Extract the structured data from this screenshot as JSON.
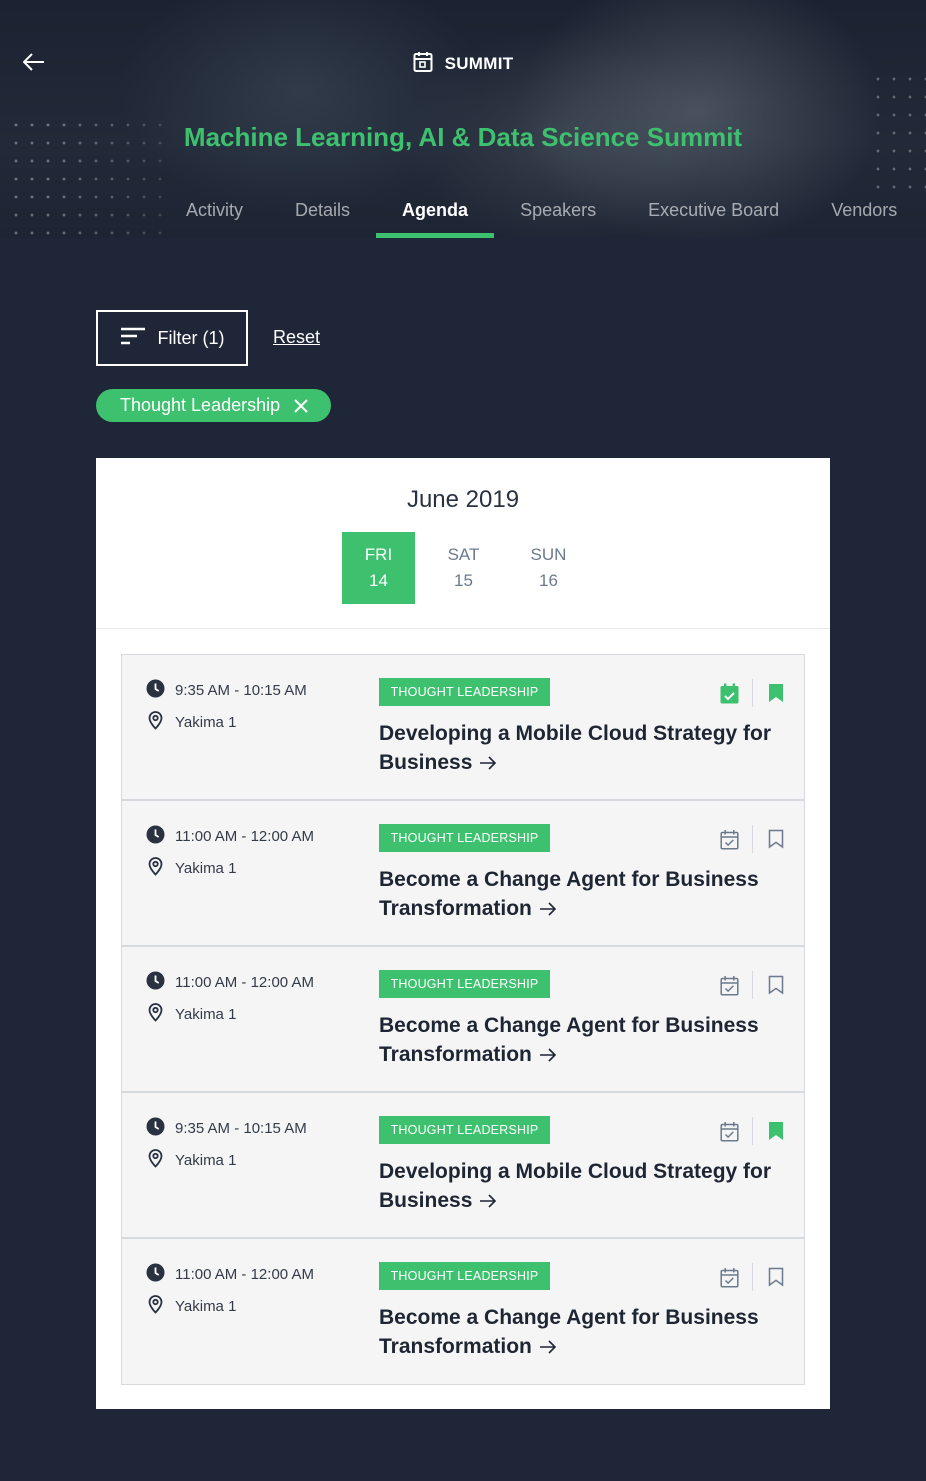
{
  "header": {
    "top_label": "SUMMIT",
    "title": "Machine Learning, AI & Data Science Summit",
    "tabs": [
      {
        "label": "Activity"
      },
      {
        "label": "Details"
      },
      {
        "label": "Agenda"
      },
      {
        "label": "Speakers"
      },
      {
        "label": "Executive Board"
      },
      {
        "label": "Vendors"
      }
    ],
    "active_tab": "Agenda"
  },
  "filters": {
    "filter_label": "Filter (1)",
    "reset_label": "Reset",
    "chip_label": "Thought Leadership"
  },
  "agenda": {
    "month": "June 2019",
    "days": [
      {
        "dow": "FRI",
        "num": "14",
        "active": true
      },
      {
        "dow": "SAT",
        "num": "15",
        "active": false
      },
      {
        "dow": "SUN",
        "num": "16",
        "active": false
      }
    ],
    "sessions": [
      {
        "time": "9:35 AM - 10:15 AM",
        "location": "Yakima 1",
        "tag": "THOUGHT LEADERSHIP",
        "title": "Developing a Mobile Cloud Strategy for Business",
        "calendar_added": true,
        "bookmarked": true
      },
      {
        "time": "11:00 AM - 12:00 AM",
        "location": "Yakima 1",
        "tag": "THOUGHT LEADERSHIP",
        "title": "Become a Change Agent for Business Transformation",
        "calendar_added": false,
        "bookmarked": false
      },
      {
        "time": "11:00 AM - 12:00 AM",
        "location": "Yakima 1",
        "tag": "THOUGHT LEADERSHIP",
        "title": "Become a Change Agent for Business Transformation",
        "calendar_added": false,
        "bookmarked": false
      },
      {
        "time": "9:35 AM - 10:15 AM",
        "location": "Yakima 1",
        "tag": "THOUGHT LEADERSHIP",
        "title": "Developing a Mobile Cloud Strategy for Business",
        "calendar_added": false,
        "bookmarked": true
      },
      {
        "time": "11:00 AM - 12:00 AM",
        "location": "Yakima 1",
        "tag": "THOUGHT LEADERSHIP",
        "title": "Become a Change Agent for Business Transformation",
        "calendar_added": false,
        "bookmarked": false
      }
    ]
  },
  "colors": {
    "accent": "#3ec16f",
    "background": "#1f2637",
    "card": "#ffffff",
    "session_bg": "#f5f5f6",
    "muted_icon": "#6a7a8c"
  },
  "icons": [
    "arrow-left-icon",
    "calendar-icon",
    "filter-lines-icon",
    "close-icon",
    "clock-icon",
    "location-pin-icon",
    "calendar-check-icon",
    "bookmark-icon",
    "arrow-right-icon"
  ]
}
